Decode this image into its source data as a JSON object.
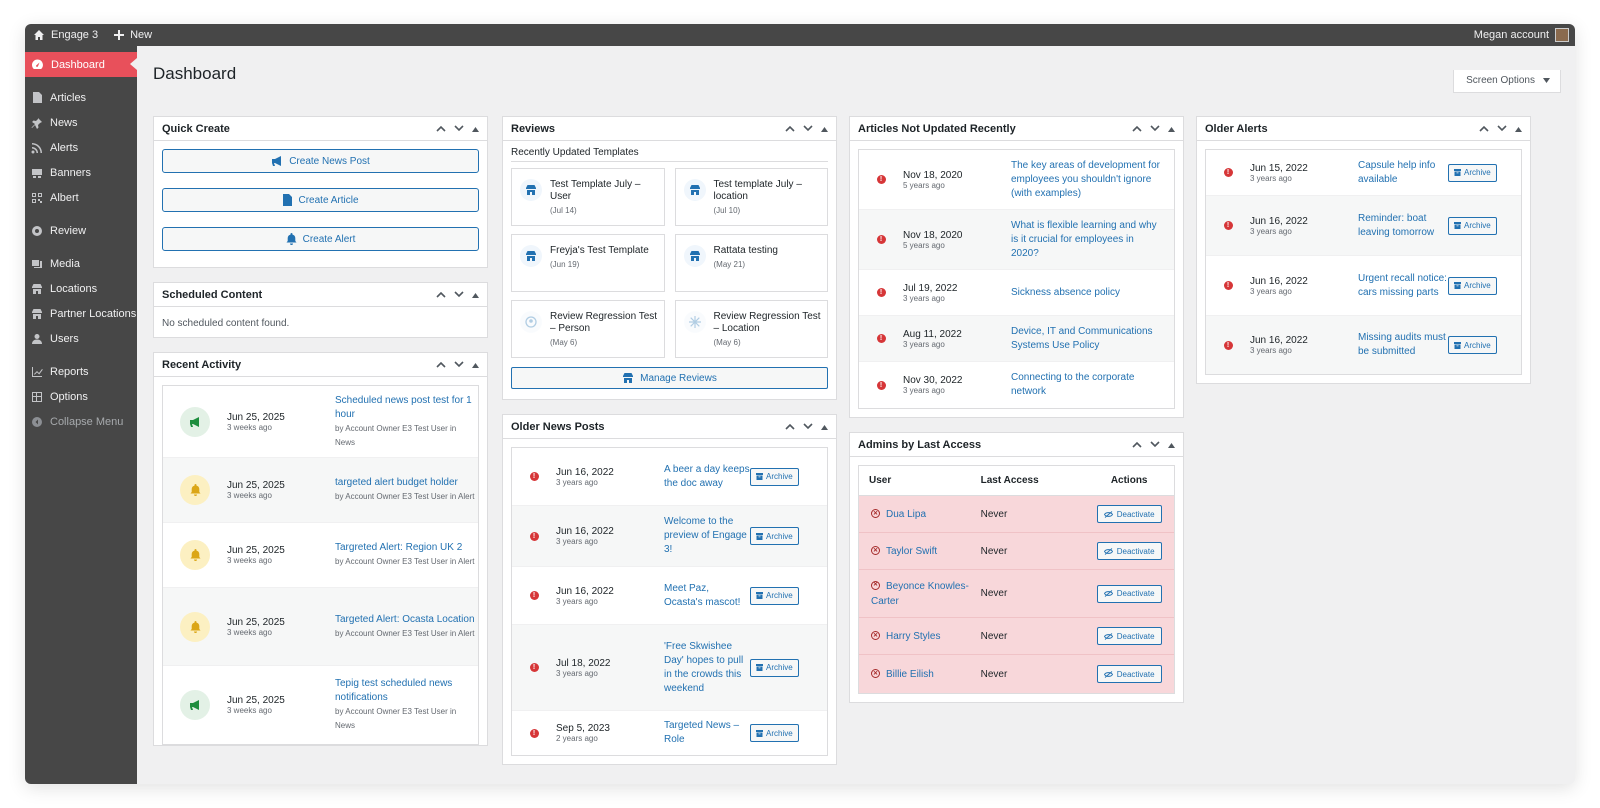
{
  "adminbar": {
    "site_name": "Engage 3",
    "new_label": "New",
    "account_label": "Megan account"
  },
  "sidebar": {
    "items": [
      {
        "label": "Dashboard"
      },
      {
        "label": "Articles"
      },
      {
        "label": "News"
      },
      {
        "label": "Alerts"
      },
      {
        "label": "Banners"
      },
      {
        "label": "Albert"
      },
      {
        "label": "Review"
      },
      {
        "label": "Media"
      },
      {
        "label": "Locations"
      },
      {
        "label": "Partner Locations"
      },
      {
        "label": "Users"
      },
      {
        "label": "Reports"
      },
      {
        "label": "Options"
      },
      {
        "label": "Collapse Menu"
      }
    ]
  },
  "page": {
    "title": "Dashboard",
    "screen_options": "Screen Options"
  },
  "quick_create": {
    "title": "Quick Create",
    "news_label": "Create News Post",
    "article_label": "Create Article",
    "alert_label": "Create Alert"
  },
  "scheduled": {
    "title": "Scheduled Content",
    "empty": "No scheduled content found."
  },
  "recent_activity": {
    "title": "Recent Activity",
    "items": [
      {
        "date": "Jun 25, 2025",
        "ago": "3 weeks ago",
        "title": "Scheduled news post test for 1 hour",
        "by": "by Account Owner E3 Test User in News"
      },
      {
        "date": "Jun 25, 2025",
        "ago": "3 weeks ago",
        "title": "targeted alert budget holder",
        "by": "by Account Owner E3 Test User in Alert"
      },
      {
        "date": "Jun 25, 2025",
        "ago": "3 weeks ago",
        "title": "Targreted Alert: Region UK 2",
        "by": "by Account Owner E3 Test User in Alert"
      },
      {
        "date": "Jun 25, 2025",
        "ago": "3 weeks ago",
        "title": "Targeted Alert: Ocasta Location",
        "by": "by Account Owner E3 Test User in Alert"
      },
      {
        "date": "Jun 25, 2025",
        "ago": "3 weeks ago",
        "title": "Tepig test scheduled news notifications",
        "by": "by Account Owner E3 Test User in News"
      }
    ]
  },
  "reviews": {
    "title": "Reviews",
    "subtitle": "Recently Updated Templates",
    "templates": [
      {
        "title": "Test Template July – User",
        "date": "(Jul 14)"
      },
      {
        "title": "Test template July – location",
        "date": "(Jul 10)"
      },
      {
        "title": "Freyja's Test Template",
        "date": "(Jun 19)"
      },
      {
        "title": "Rattata testing",
        "date": "(May 21)"
      },
      {
        "title": "Review Regression Test – Person",
        "date": "(May 6)"
      },
      {
        "title": "Review Regression Test – Location",
        "date": "(May 6)"
      }
    ],
    "manage_label": "Manage Reviews"
  },
  "older_news": {
    "title": "Older News Posts",
    "archive_label": "Archive",
    "items": [
      {
        "date": "Jun 16, 2022",
        "ago": "3 years ago",
        "title": "A beer a day keeps the doc away"
      },
      {
        "date": "Jun 16, 2022",
        "ago": "3 years ago",
        "title": "Welcome to the preview of Engage 3!"
      },
      {
        "date": "Jun 16, 2022",
        "ago": "3 years ago",
        "title": "Meet Paz, Ocasta's mascot!"
      },
      {
        "date": "Jul 18, 2022",
        "ago": "3 years ago",
        "title": "'Free Skwishee Day' hopes to pull in the crowds this weekend"
      },
      {
        "date": "Sep 5, 2023",
        "ago": "2 years ago",
        "title": "Targeted News – Role"
      }
    ]
  },
  "articles_old": {
    "title": "Articles Not Updated Recently",
    "items": [
      {
        "date": "Nov 18, 2020",
        "ago": "5 years ago",
        "title": "The key areas of development for employees you shouldn't ignore (with examples)"
      },
      {
        "date": "Nov 18, 2020",
        "ago": "5 years ago",
        "title": "What is flexible learning and why is it crucial for employees in 2020?"
      },
      {
        "date": "Jul 19, 2022",
        "ago": "3 years ago",
        "title": "Sickness absence policy"
      },
      {
        "date": "Aug 11, 2022",
        "ago": "3 years ago",
        "title": "Device, IT and Communications Systems Use Policy"
      },
      {
        "date": "Nov 30, 2022",
        "ago": "3 years ago",
        "title": "Connecting to the corporate network"
      }
    ]
  },
  "admins": {
    "title": "Admins by Last Access",
    "col_user": "User",
    "col_access": "Last Access",
    "col_actions": "Actions",
    "deactivate_label": "Deactivate",
    "rows": [
      {
        "name": "Dua Lipa",
        "access": "Never"
      },
      {
        "name": "Taylor Swift",
        "access": "Never"
      },
      {
        "name": "Beyonce Knowles-Carter",
        "access": "Never"
      },
      {
        "name": "Harry Styles",
        "access": "Never"
      },
      {
        "name": "Billie Eilish",
        "access": "Never"
      }
    ]
  },
  "older_alerts": {
    "title": "Older Alerts",
    "archive_label": "Archive",
    "items": [
      {
        "date": "Jun 15, 2022",
        "ago": "3 years ago",
        "title": "Capsule help info available"
      },
      {
        "date": "Jun 16, 2022",
        "ago": "3 years ago",
        "title": "Reminder: boat leaving tomorrow"
      },
      {
        "date": "Jun 16, 2022",
        "ago": "3 years ago",
        "title": "Urgent recall notice: cars missing parts"
      },
      {
        "date": "Jun 16, 2022",
        "ago": "3 years ago",
        "title": "Missing audits must be submitted"
      }
    ]
  },
  "colors": {
    "accent": "#2271b1",
    "active_menu": "#e8505b",
    "error": "#d63638",
    "admin_row": "#f8d7da"
  }
}
